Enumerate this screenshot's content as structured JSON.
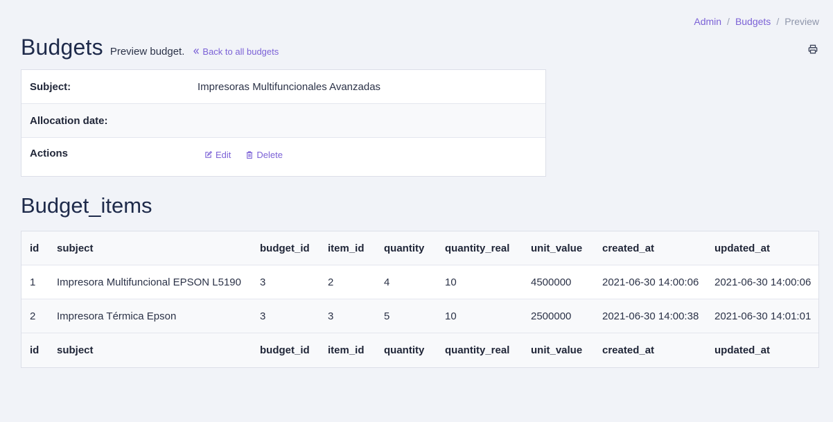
{
  "breadcrumb": {
    "items": [
      "Admin",
      "Budgets"
    ],
    "separator": "/",
    "current": "Preview"
  },
  "header": {
    "title": "Budgets",
    "subtitle": "Preview budget.",
    "back_link": "Back to all budgets",
    "print_icon": "printer-icon"
  },
  "details": {
    "subject_label": "Subject:",
    "subject_value": "Impresoras Multifuncionales Avanzadas",
    "allocation_label": "Allocation date:",
    "allocation_value": "",
    "actions_label": "Actions",
    "edit_label": "Edit",
    "delete_label": "Delete"
  },
  "items_section": {
    "title": "Budget_items",
    "columns": [
      "id",
      "subject",
      "budget_id",
      "item_id",
      "quantity",
      "quantity_real",
      "unit_value",
      "created_at",
      "updated_at"
    ],
    "rows": [
      [
        "1",
        "Impresora Multifuncional EPSON L5190",
        "3",
        "2",
        "4",
        "10",
        "4500000",
        "2021-06-30 14:00:06",
        "2021-06-30 14:00:06"
      ],
      [
        "2",
        "Impresora Térmica Epson",
        "3",
        "3",
        "5",
        "10",
        "2500000",
        "2021-06-30 14:00:38",
        "2021-06-30 14:01:01"
      ]
    ]
  },
  "colors": {
    "accent": "#7b61d6",
    "background": "#f1f3f8",
    "heading": "#1e2a4a"
  }
}
